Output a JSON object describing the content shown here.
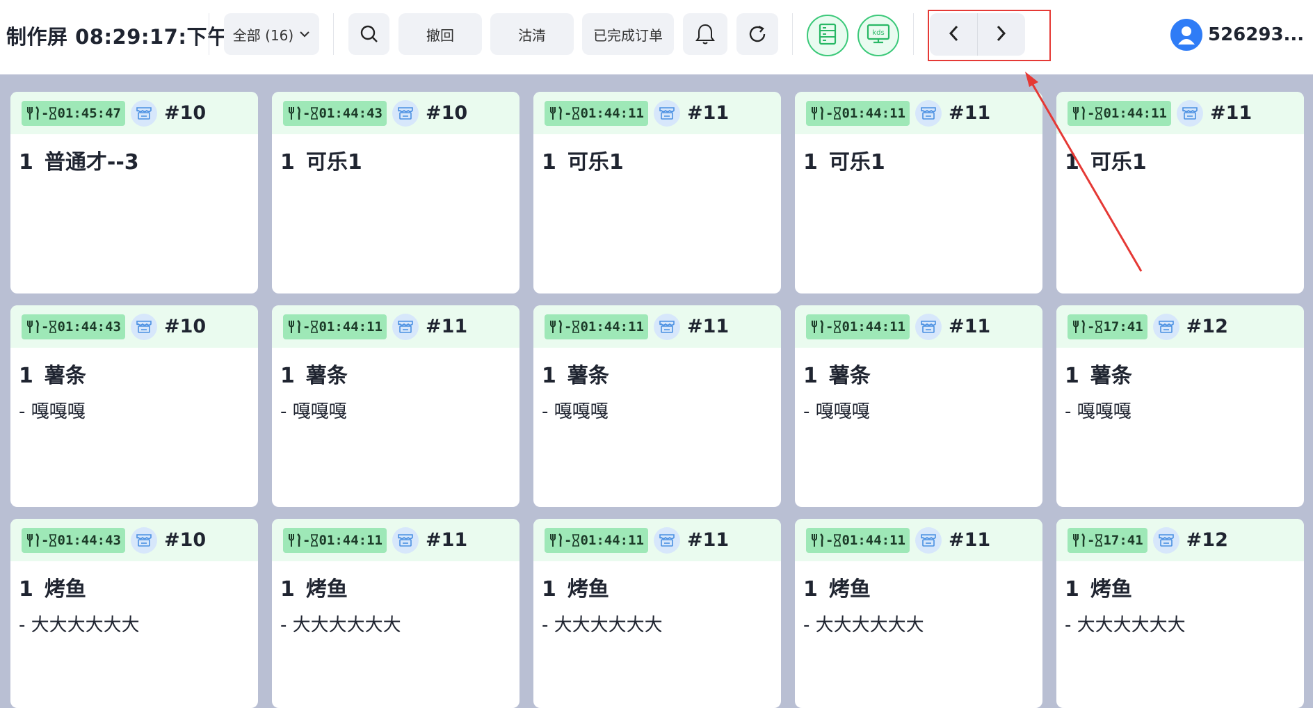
{
  "header": {
    "title": "制作屏 08:29:17:下午",
    "filter_label": "全部 (16)",
    "undo_label": "撤回",
    "clear_label": "沽清",
    "completed_label": "已完成订单",
    "user_name": "526293...",
    "kds_icon_text": "kds"
  },
  "annotation": {
    "box_color": "#e53935"
  },
  "cards": [
    {
      "timer": "01:45:47",
      "order": "#10",
      "qty": "1",
      "item": "普通才--3",
      "mod": ""
    },
    {
      "timer": "01:44:43",
      "order": "#10",
      "qty": "1",
      "item": "可乐1",
      "mod": ""
    },
    {
      "timer": "01:44:11",
      "order": "#11",
      "qty": "1",
      "item": "可乐1",
      "mod": ""
    },
    {
      "timer": "01:44:11",
      "order": "#11",
      "qty": "1",
      "item": "可乐1",
      "mod": ""
    },
    {
      "timer": "01:44:11",
      "order": "#11",
      "qty": "1",
      "item": "可乐1",
      "mod": ""
    },
    {
      "timer": "01:44:43",
      "order": "#10",
      "qty": "1",
      "item": "薯条",
      "mod": "- 嘎嘎嘎"
    },
    {
      "timer": "01:44:11",
      "order": "#11",
      "qty": "1",
      "item": "薯条",
      "mod": "- 嘎嘎嘎"
    },
    {
      "timer": "01:44:11",
      "order": "#11",
      "qty": "1",
      "item": "薯条",
      "mod": "- 嘎嘎嘎"
    },
    {
      "timer": "01:44:11",
      "order": "#11",
      "qty": "1",
      "item": "薯条",
      "mod": "- 嘎嘎嘎"
    },
    {
      "timer": "17:41",
      "order": "#12",
      "qty": "1",
      "item": "薯条",
      "mod": "- 嘎嘎嘎"
    },
    {
      "timer": "01:44:43",
      "order": "#10",
      "qty": "1",
      "item": "烤鱼",
      "mod": "- 大大大大大大"
    },
    {
      "timer": "01:44:11",
      "order": "#11",
      "qty": "1",
      "item": "烤鱼",
      "mod": "- 大大大大大大"
    },
    {
      "timer": "01:44:11",
      "order": "#11",
      "qty": "1",
      "item": "烤鱼",
      "mod": "- 大大大大大大"
    },
    {
      "timer": "01:44:11",
      "order": "#11",
      "qty": "1",
      "item": "烤鱼",
      "mod": "- 大大大大大大"
    },
    {
      "timer": "17:41",
      "order": "#12",
      "qty": "1",
      "item": "烤鱼",
      "mod": "- 大大大大大大"
    }
  ]
}
